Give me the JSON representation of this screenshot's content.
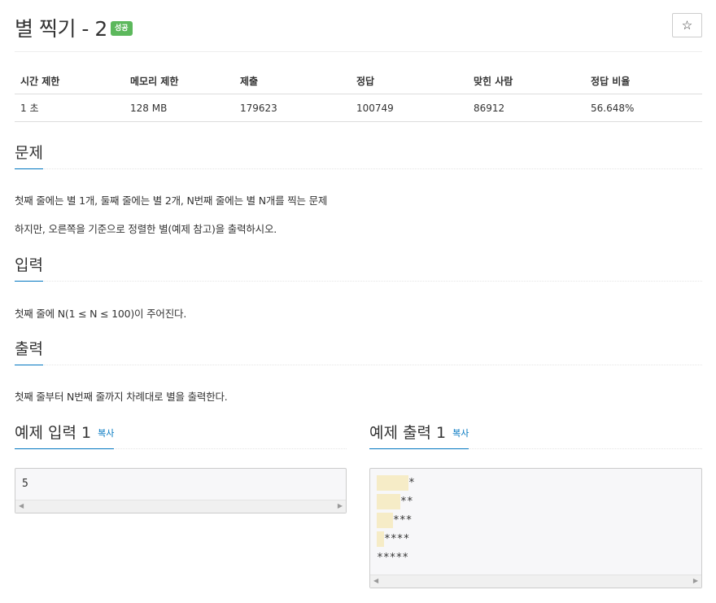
{
  "problem": {
    "title": "별 찍기 - 2",
    "badge": "성공",
    "star": "☆"
  },
  "info": {
    "headers": [
      "시간 제한",
      "메모리 제한",
      "제출",
      "정답",
      "맞힌 사람",
      "정답 비율"
    ],
    "values": [
      "1 초",
      "128 MB",
      "179623",
      "100749",
      "86912",
      "56.648%"
    ]
  },
  "sections": {
    "problem": {
      "title": "문제",
      "lines": [
        "첫째 줄에는 별 1개, 둘째 줄에는 별 2개, N번째 줄에는 별 N개를 찍는 문제",
        "하지만, 오른쪽을 기준으로 정렬한 별(예제 참고)을 출력하시오."
      ]
    },
    "input": {
      "title": "입력",
      "lines": [
        "첫째 줄에 N(1 ≤ N ≤ 100)이 주어진다."
      ]
    },
    "output": {
      "title": "출력",
      "lines": [
        "첫째 줄부터 N번째 줄까지 차례대로 별을 출력한다."
      ]
    }
  },
  "examples": {
    "input": {
      "title": "예제 입력 1",
      "copy": "복사",
      "lines": [
        "5"
      ]
    },
    "output": {
      "title": "예제 출력 1",
      "copy": "복사",
      "lines": [
        "*",
        "**",
        "***",
        "****",
        "*****"
      ]
    }
  }
}
